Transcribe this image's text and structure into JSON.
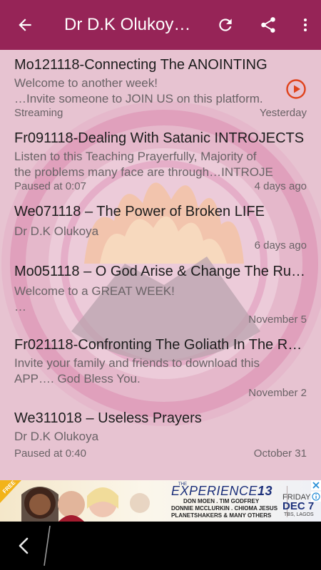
{
  "appbar": {
    "title": "Dr D.K Olukoyа…",
    "back_icon": "arrow-left-icon",
    "refresh_icon": "refresh-icon",
    "share_icon": "share-icon",
    "more_icon": "more-vert-icon"
  },
  "episodes": [
    {
      "title": "Mo121118-Connecting The ANOINTING",
      "description": "Welcome to another week!\n…Invite someone to JOIN US on this platform.",
      "status": "Streaming",
      "date": "Yesterday"
    },
    {
      "title": "Fr091118-Dealing With Satanic INTROJECTS",
      "description": "Listen to this Teaching Prayerfully, Majority of\nthe problems many face are through…INTROJE",
      "status": "Paused at 0:07",
      "date": "4 days ago"
    },
    {
      "title": "We071118 – The Power of Broken LIFE",
      "description": "Dr D.K Olukoya",
      "status": "",
      "date": "6 days ago"
    },
    {
      "title": "Mo051118 – O God Arise & Change The Rul…",
      "description": "Welcome to a GREAT WEEK!\n…",
      "status": "",
      "date": "November 5"
    },
    {
      "title": "Fr021118-Confronting The Goliath In The RO…",
      "description": "Invite your family and friends to download this\nAPP…. God Bless You.",
      "status": "",
      "date": "November 2"
    },
    {
      "title": "We311018 – Useless Prayers",
      "description": "Dr D.K Olukoya",
      "status": "Paused at 0:40",
      "date": "October 31"
    }
  ],
  "ad": {
    "badge": "FREE",
    "the": "THE",
    "event_pre": "EXPERIENCE",
    "event_num": "13",
    "line1": "DON MOEN . TIM GODFREY",
    "line2": "DONNIE MCCLURKIN . CHIOMA JESUS",
    "line3": "PLANETSHAKERS & MANY OTHERS",
    "day": "FRIDAY",
    "date": "DEC 7",
    "venue": "TBS, LAGOS",
    "close_icon": "close-icon",
    "info_icon": "info-icon",
    "brand_color": "#1b2f7a"
  },
  "colors": {
    "appbar": "#962457",
    "accent": "#e0431c"
  }
}
